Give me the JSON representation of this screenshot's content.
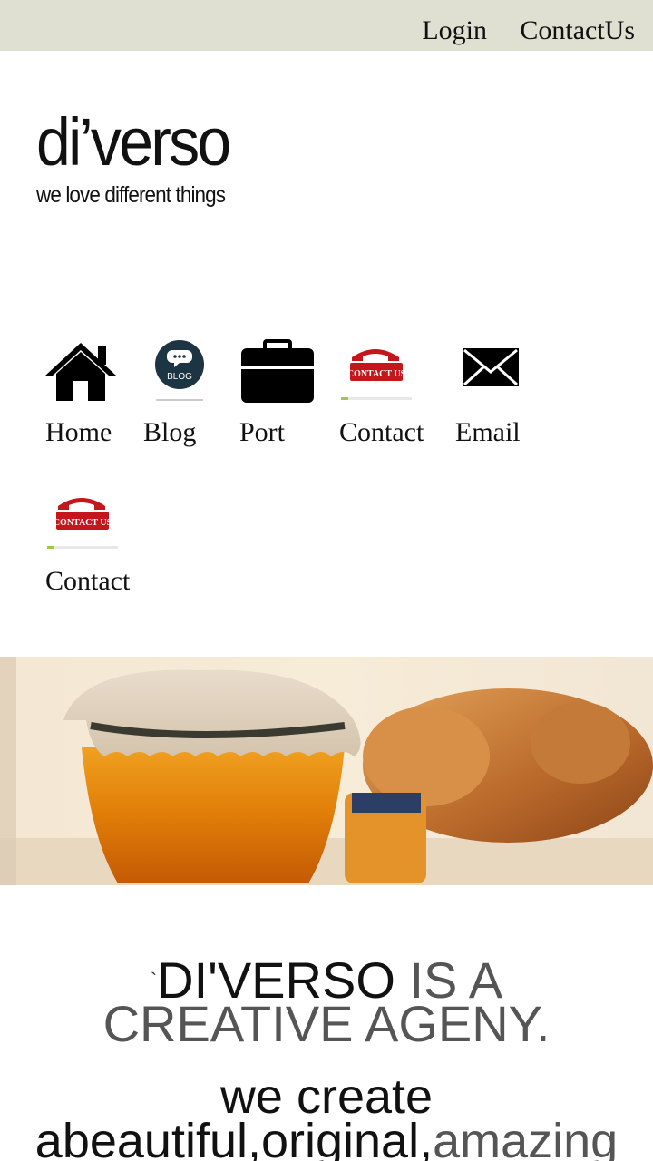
{
  "topbar": {
    "login_label": "Login",
    "contact_label": "ContactUs",
    "background": "#e0e0d2"
  },
  "brand": {
    "title": "di’verso",
    "tagline": "we love different things"
  },
  "nav": {
    "items": [
      {
        "label": "Home",
        "icon": "house-icon"
      },
      {
        "label": "Blog",
        "icon": "blog-bubble-icon",
        "icon_text": "BLOG"
      },
      {
        "label": "Port",
        "icon": "briefcase-icon"
      },
      {
        "label": "Contact",
        "icon": "contact-us-phone-icon",
        "icon_text": "CONTACT US"
      },
      {
        "label": "Email",
        "icon": "envelope-icon"
      },
      {
        "label": "Contact",
        "icon": "contact-us-phone-icon",
        "icon_text": "CONTACT US"
      }
    ]
  },
  "hero": {
    "image": "honey-jar-and-croissant-photo"
  },
  "headline": {
    "tick": "`",
    "part1": "DI'VERSO",
    "part2": " IS A",
    "line2": "CREATIVE AGENY."
  },
  "subheadline": {
    "line1": "we create",
    "line2_part1": "abeautiful,original,",
    "line2_part2": "amazing"
  },
  "colors": {
    "accent_red": "#c4161c",
    "text_dark": "#111111",
    "text_grey": "#555555"
  }
}
